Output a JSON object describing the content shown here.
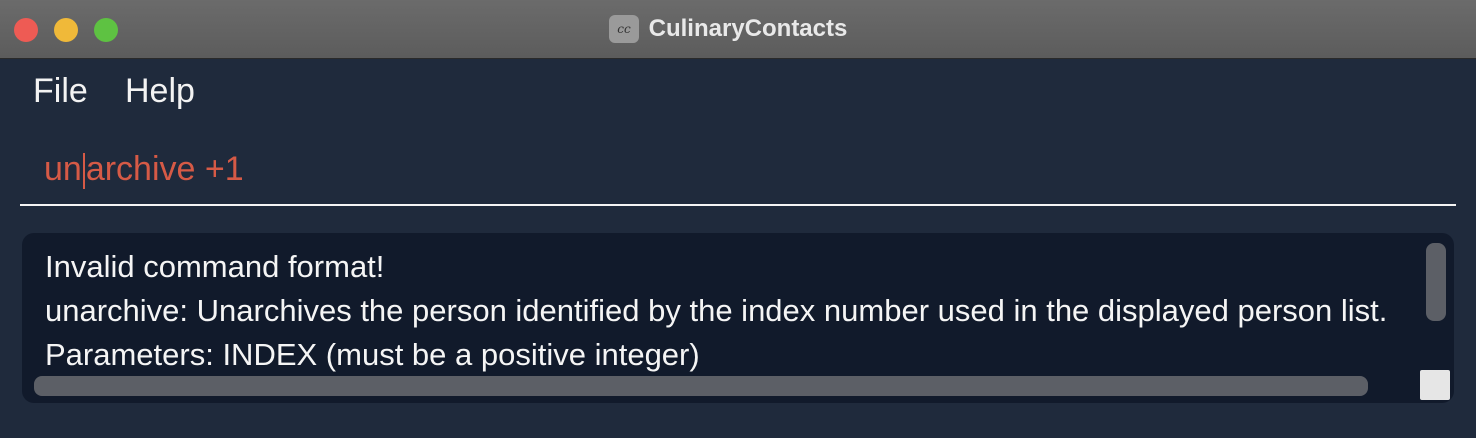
{
  "window": {
    "title": "CulinaryContacts",
    "app_icon": "culinarycontacts-app-icon"
  },
  "menu": {
    "items": [
      {
        "label": "File"
      },
      {
        "label": "Help"
      }
    ]
  },
  "command_box": {
    "text_before_caret": "un",
    "text_after_caret": "archive +1",
    "color": "#d65a46"
  },
  "result_display": {
    "lines": [
      "Invalid command format!",
      "unarchive: Unarchives the person identified by the index number used in the displayed person list.",
      "Parameters: INDEX (must be a positive integer)"
    ]
  }
}
